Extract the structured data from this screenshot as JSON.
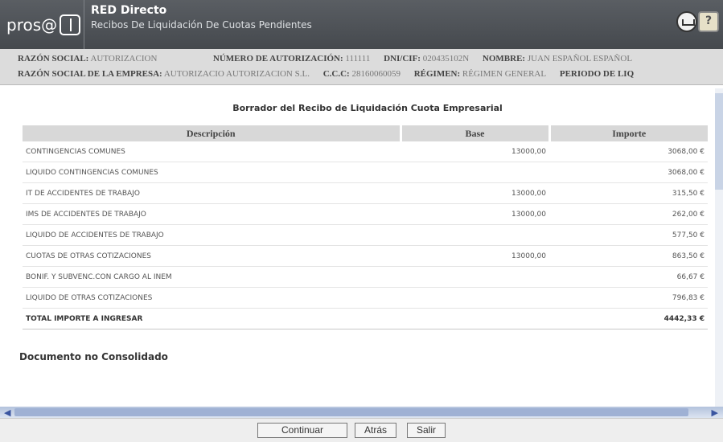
{
  "header": {
    "logo_text": "pros@",
    "app_name": "RED Directo",
    "subtitle": "Recibos De Liquidación De Cuotas Pendientes"
  },
  "info": {
    "row1": [
      {
        "label": "RAZÓN SOCIAL:",
        "value": "AUTORIZACION"
      },
      {
        "label": "NÚMERO DE AUTORIZACIÓN:",
        "value": "111111"
      },
      {
        "label": "DNI/CIF:",
        "value": "020435102N"
      },
      {
        "label": "NOMBRE:",
        "value": "JUAN ESPAÑOL ESPAÑOL"
      }
    ],
    "row2": [
      {
        "label": "RAZÓN SOCIAL DE LA EMPRESA:",
        "value": "AUTORIZACIO AUTORIZACION  S.L."
      },
      {
        "label": "C.C.C:",
        "value": "28160060059"
      },
      {
        "label": "RÉGIMEN:",
        "value": "RÉGIMEN GENERAL"
      },
      {
        "label": "PERIODO DE LIQ",
        "value": ""
      }
    ]
  },
  "receipt": {
    "title": "Borrador del Recibo de Liquidación Cuota Empresarial",
    "columns": [
      "Descripción",
      "Base",
      "Importe"
    ],
    "rows": [
      {
        "desc": "CONTINGENCIAS COMUNES",
        "base": "13000,00",
        "importe": "3068,00 €"
      },
      {
        "desc": "LIQUIDO CONTINGENCIAS COMUNES",
        "base": "",
        "importe": "3068,00 €"
      },
      {
        "desc": "IT DE ACCIDENTES DE TRABAJO",
        "base": "13000,00",
        "importe": "315,50 €"
      },
      {
        "desc": "IMS DE ACCIDENTES DE TRABAJO",
        "base": "13000,00",
        "importe": "262,00 €"
      },
      {
        "desc": "LIQUIDO DE ACCIDENTES DE TRABAJO",
        "base": "",
        "importe": "577,50 €"
      },
      {
        "desc": "CUOTAS DE OTRAS COTIZACIONES",
        "base": "13000,00",
        "importe": "863,50 €"
      },
      {
        "desc": "BONIF. Y SUBVENC.CON CARGO AL INEM",
        "base": "",
        "importe": "66,67 €"
      },
      {
        "desc": "LIQUIDO DE OTRAS COTIZACIONES",
        "base": "",
        "importe": "796,83 €"
      }
    ],
    "total": {
      "desc": "TOTAL IMPORTE A INGRESAR",
      "importe": "4442,33 €"
    },
    "status": "Documento no Consolidado"
  },
  "buttons": {
    "continuar": "Continuar",
    "atras": "Atrás",
    "salir": "Salir"
  },
  "icons": {
    "home": "home-icon",
    "help": "help-icon",
    "scroll_left": "◀",
    "scroll_right": "▶"
  }
}
